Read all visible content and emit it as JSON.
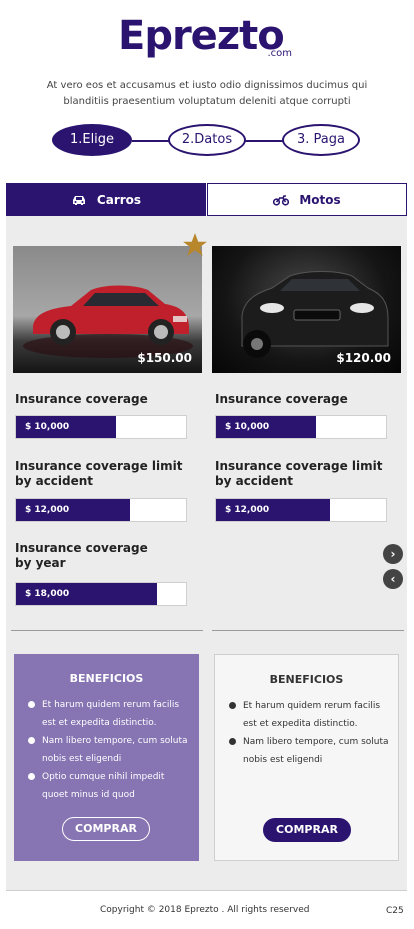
{
  "header": {
    "logo_text": "Eprezto",
    "logo_suffix": ".com",
    "intro": "At vero eos et accusamus et iusto odio dignissimos ducimus qui blanditiis praesentium voluptatum deleniti atque corrupti"
  },
  "steps": [
    {
      "label": "1.Elige",
      "active": true
    },
    {
      "label": "2.Datos",
      "active": false
    },
    {
      "label": "3. Paga",
      "active": false
    }
  ],
  "tabs": [
    {
      "label": "Carros",
      "icon": "car-icon",
      "active": true
    },
    {
      "label": "Motos",
      "icon": "motorcycle-icon",
      "active": false
    }
  ],
  "cars": [
    {
      "price": "$150.00",
      "color": "#c0202c",
      "featured": true
    },
    {
      "price": "$120.00",
      "color": "#1a1a1a",
      "featured": false
    }
  ],
  "coverage": {
    "left": [
      {
        "label": "Insurance coverage",
        "value": "$ 10,000",
        "fill_pct": 59
      },
      {
        "label_line1": "Insurance coverage limit",
        "label_line2": "by accident",
        "value": "$ 12,000",
        "fill_pct": 67
      },
      {
        "label_line1": "Insurance coverage",
        "label_line2": "by year",
        "value": "$ 18,000",
        "fill_pct": 83
      }
    ],
    "right": [
      {
        "label": "Insurance coverage",
        "value": "$ 10,000",
        "fill_pct": 59
      },
      {
        "label_line1": "Insurance coverage limit",
        "label_line2": "by accident",
        "value": "$ 12,000",
        "fill_pct": 67
      }
    ]
  },
  "nav": {
    "next_icon": "chevron-right-icon",
    "prev_icon": "chevron-left-icon"
  },
  "benefits": [
    {
      "title": "BENEFICIOS",
      "items": [
        "Et harum quidem rerum facilis est et expedita distinctio.",
        "Nam libero tempore, cum soluta nobis est eligendi",
        "Optio cumque nihil impedit quoet minus id quod"
      ],
      "button": "COMPRAR"
    },
    {
      "title": "BENEFICIOS",
      "items": [
        "Et harum quidem rerum facilis est et expedita distinctio.",
        "Nam libero tempore, cum soluta nobis est eligendi"
      ],
      "button": "COMPRAR"
    }
  ],
  "footer": {
    "copyright": "Copyright © 2018 Eprezto . All rights reserved",
    "code": "C25"
  },
  "colors": {
    "brand": "#2b1470",
    "benefit_purple": "#8674b3",
    "star": "#b8862b",
    "panel": "#ececec"
  }
}
